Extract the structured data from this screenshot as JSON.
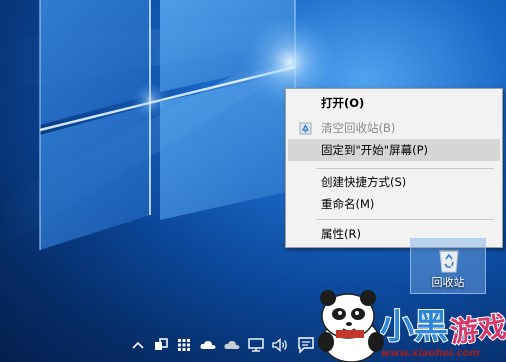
{
  "context_menu": {
    "items": [
      {
        "label": "打开(O)",
        "bold": true,
        "disabled": false,
        "highlighted": false
      },
      {
        "label": "清空回收站(B)",
        "bold": false,
        "disabled": true,
        "highlighted": false,
        "icon": "shield-icon"
      },
      {
        "label": "固定到\"开始\"屏幕(P)",
        "bold": false,
        "disabled": false,
        "highlighted": true
      },
      {
        "label": "创建快捷方式(S)",
        "bold": false,
        "disabled": false,
        "highlighted": false
      },
      {
        "label": "重命名(M)",
        "bold": false,
        "disabled": false,
        "highlighted": false
      },
      {
        "label": "属性(R)",
        "bold": false,
        "disabled": false,
        "highlighted": false
      }
    ]
  },
  "desktop": {
    "recycle_bin_label": "回收站"
  },
  "tray": {
    "icons": [
      "chevron-up-icon",
      "task-view-icon",
      "grid-icon",
      "cloud-icon",
      "cloud-icon",
      "network-icon",
      "volume-icon",
      "action-center-icon"
    ]
  },
  "watermark": {
    "logo_text": "小黑游戏",
    "url": "www.xiaohei.com"
  },
  "colors": {
    "menu_background": "#f2f2f2",
    "menu_highlight": "#d6d6d6",
    "disabled_text": "#8a8a8a",
    "wallpaper_blue": "#0b4799"
  }
}
